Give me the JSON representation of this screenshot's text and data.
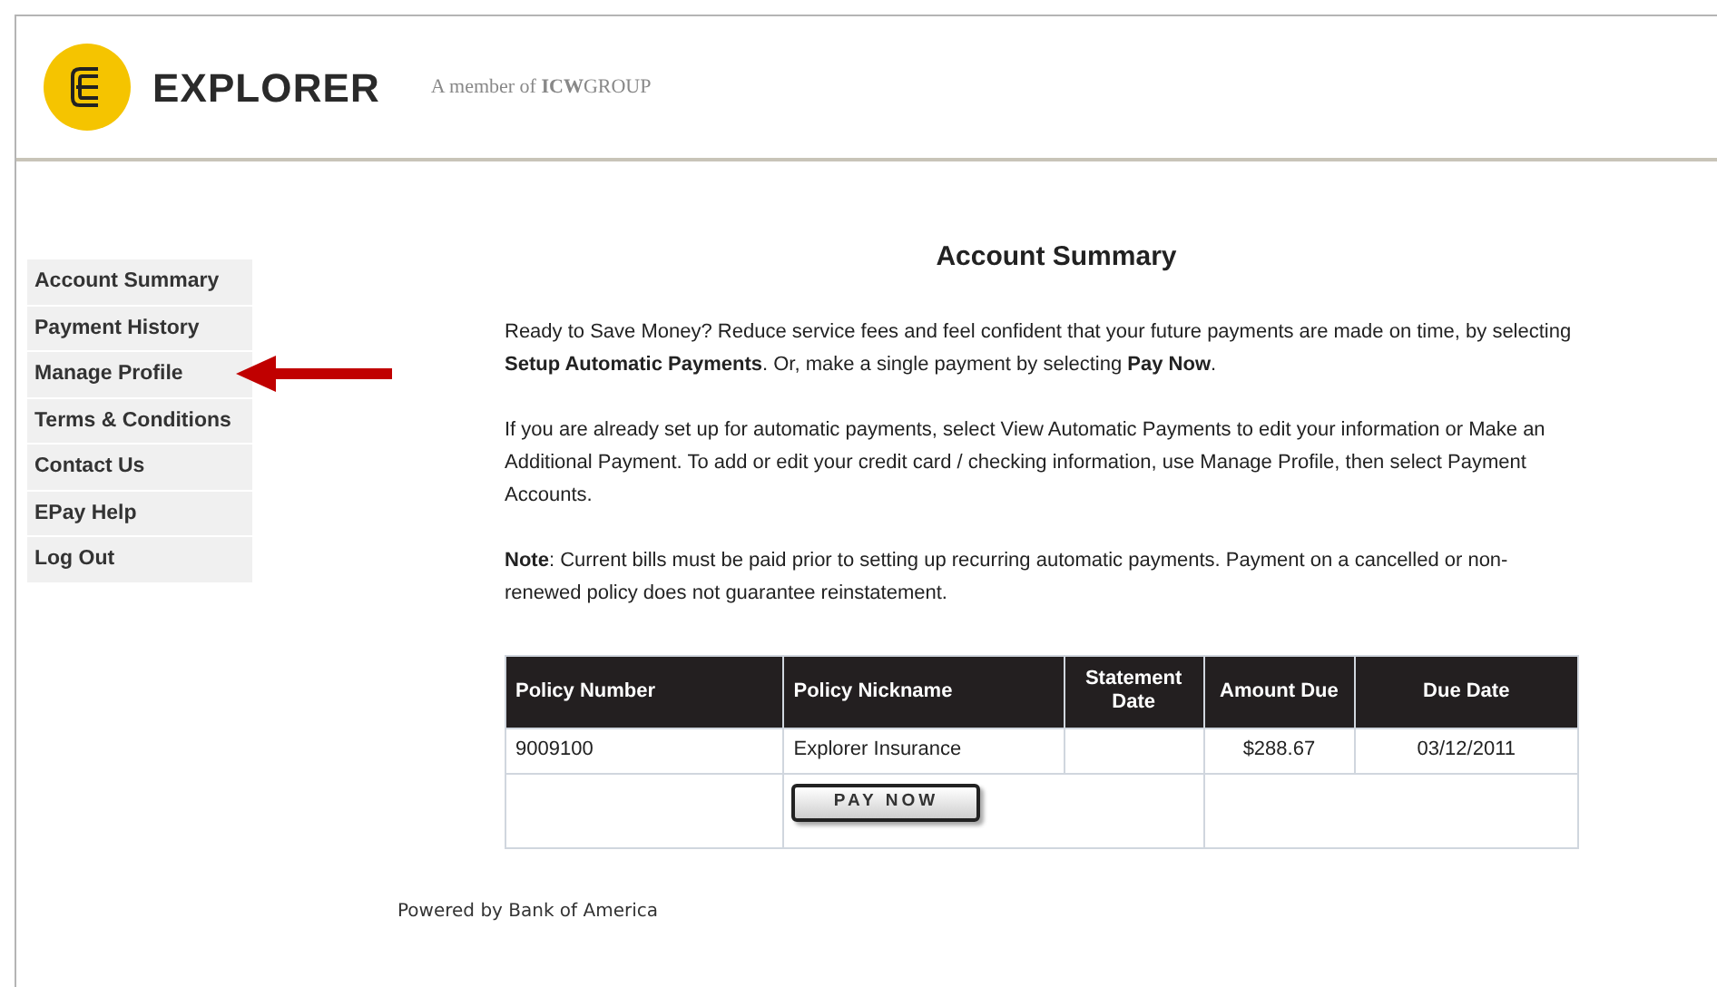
{
  "header": {
    "brand": "EXPLORER",
    "tagline": "A member of **ICW**GROUP"
  },
  "sidebar": {
    "items": [
      {
        "label": "Account Summary"
      },
      {
        "label": "Payment History"
      },
      {
        "label": "Manage Profile"
      },
      {
        "label": "Terms & Conditions"
      },
      {
        "label": "Contact Us"
      },
      {
        "label": "EPay Help"
      },
      {
        "label": "Log Out"
      }
    ]
  },
  "main": {
    "title": "Account Summary",
    "paragraphs": [
      "Ready to Save Money? Reduce service fees and feel confident that your future payments are made on time, by selecting **Setup Automatic Payments**. Or, make a single payment by selecting **Pay Now**.",
      "If you are already set up for automatic payments, select View Automatic Payments to edit your information or Make an Additional Payment. To add or edit your credit card / checking information, use Manage Profile, then select Payment Accounts.",
      "**Note**: Current bills must be paid prior to setting up recurring automatic payments. Payment on a cancelled or non-renewed policy does not guarantee reinstatement."
    ],
    "table": {
      "columns": [
        "Policy Number",
        "Policy Nickname",
        "Statement Date",
        "Amount Due",
        "Due Date"
      ],
      "rows": [
        [
          "9009100",
          "Explorer Insurance",
          "",
          "$288.67",
          "03/12/2011"
        ]
      ],
      "pay_button": "PAY NOW"
    }
  },
  "footer": "Powered by Bank of America"
}
